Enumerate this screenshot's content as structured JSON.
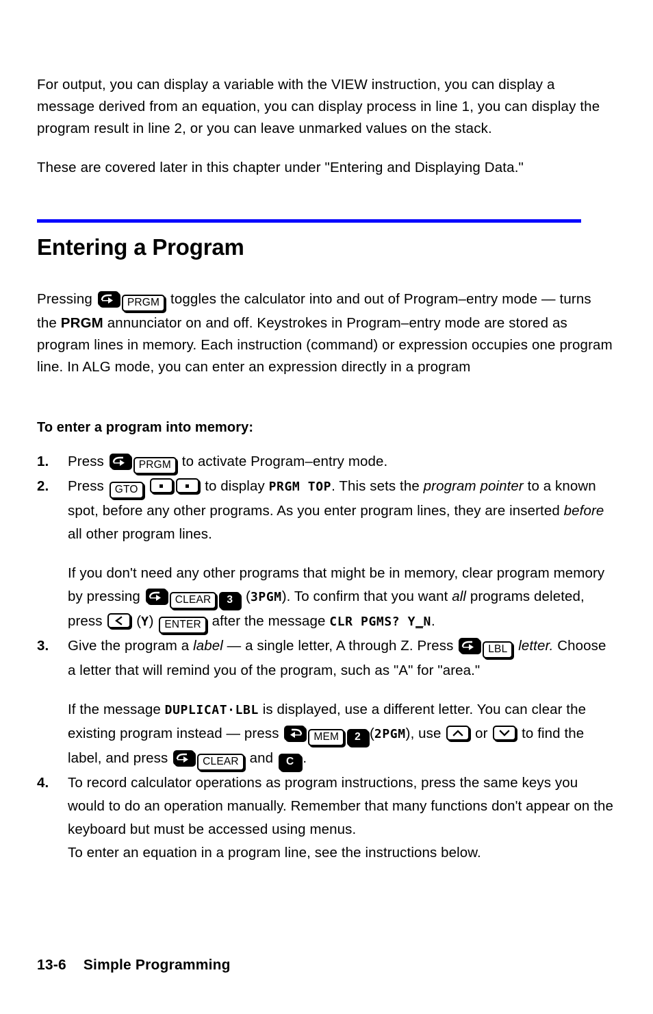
{
  "document": {
    "intro_paragraphs": [
      "For output, you can display a variable with the VIEW instruction, you can display a message derived from an equation, you can display process in line 1, you can display the program result in line 2, or you can leave unmarked values on the stack.",
      "These are covered later in this chapter under \"Entering and Displaying Data.\""
    ],
    "section": {
      "title": "Entering a Program",
      "rule_color": "#0000ff",
      "intro": {
        "part1": "Pressing ",
        "part2": " toggles the calculator into and out of Program–entry mode — turns the ",
        "annunciator": "PRGM",
        "part3": " annunciator on and off. Keystrokes in Program–entry mode are stored as program lines in memory. Each instruction (command) or expression occupies one program line. In ALG mode, you can enter an expression directly in a program"
      }
    },
    "subhead": "To enter a program into memory:",
    "steps": [
      {
        "num": "1.",
        "t1": "Press ",
        "t2": " to activate Program–entry mode."
      },
      {
        "num": "2.",
        "t1": "Press ",
        "t2": " to display ",
        "lcd": "PRGM TOP",
        "t3": ". This sets the ",
        "em1": "program pointer",
        "t4": " to a known spot, before any other programs. As you enter program lines, they are inserted ",
        "em2": "before",
        "t5": " all other program lines.",
        "sub": {
          "s1": "If you don't need any other programs that might be in memory, clear program memory by pressing ",
          "s2": " (",
          "lcd1": "3PGM",
          "s3": "). To confirm that you want ",
          "em1": "all",
          "s4": " programs deleted, press ",
          "s5": " (",
          "lcd2": "Y",
          "s6": ") ",
          "s7": " after the message ",
          "lcd3a": "CLR PGMS? Y",
          "lcd3b": "_",
          "lcd3c": "N",
          "s8": "."
        }
      },
      {
        "num": "3.",
        "t1": "Give the program a ",
        "em1": "label",
        "t2": " — a single letter, A through Z. Press ",
        "t3": " ",
        "em2": "letter.",
        "t4": " Choose a letter that will remind you of the program, such as \"A\" for \"area.\"",
        "sub": {
          "s1": "If the message ",
          "lcd1": "DUPLICAT·LBL",
          "s2": " is displayed, use a different letter. You can clear the existing program instead — press ",
          "s3": "(",
          "lcd2": "2PGM",
          "s4": "), use ",
          "s5": " or ",
          "s6": " to find the label, and press ",
          "s7": " and ",
          "s8": "."
        }
      },
      {
        "num": "4.",
        "t1": "To record calculator operations as program instructions, press the same keys you would to do an operation manually. Remember that many functions don't appear on the keyboard but must be accessed using menus.",
        "t2": "To enter an equation in a program line, see the instructions below."
      }
    ],
    "keys": {
      "prgm": "PRGM",
      "gto": "GTO",
      "clear": "CLEAR",
      "three": "3",
      "enter": "ENTER",
      "lbl": "LBL",
      "mem": "MEM",
      "two": "2",
      "c": "C"
    },
    "footer": {
      "page": "13-6",
      "chapter": "Simple Programming"
    }
  }
}
